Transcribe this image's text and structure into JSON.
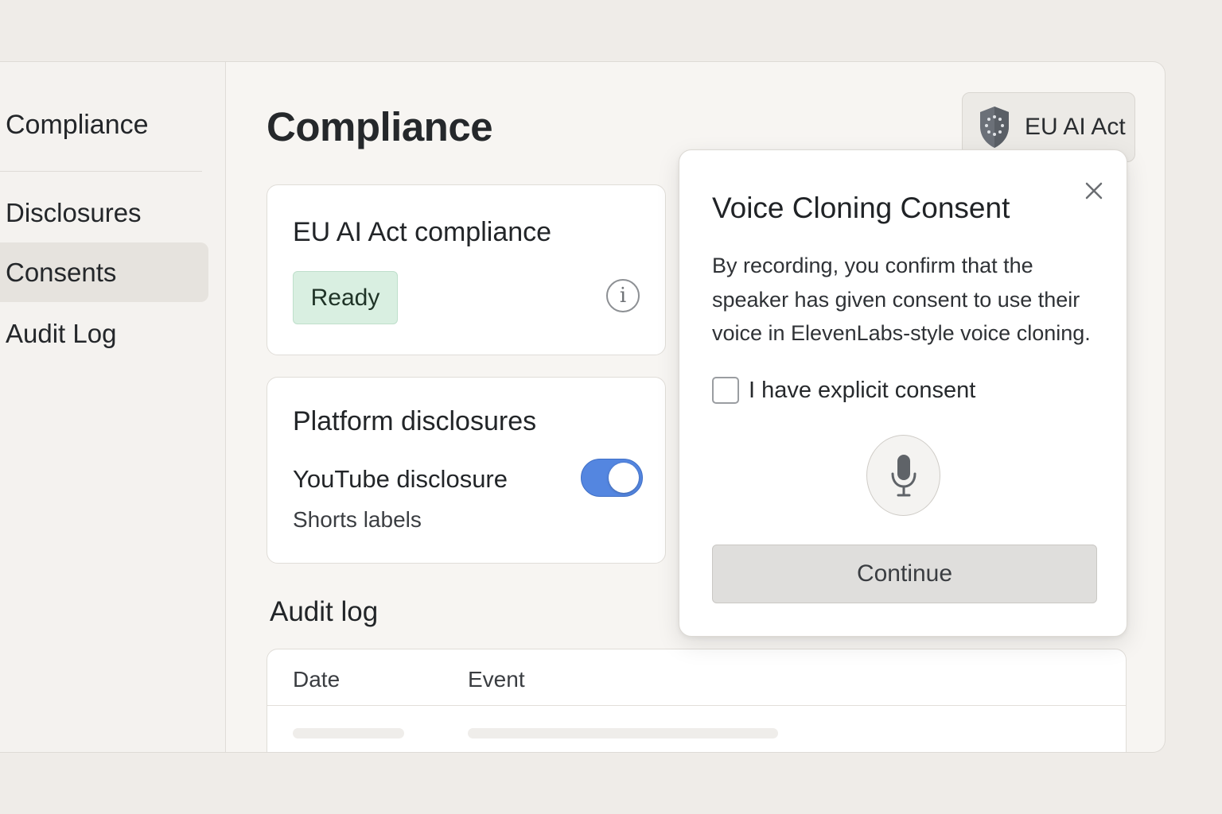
{
  "sidebar": {
    "title": "Compliance",
    "items": [
      {
        "label": "Disclosures"
      },
      {
        "label": "Consents"
      },
      {
        "label": "Audit Log"
      }
    ]
  },
  "header": {
    "title": "Compliance",
    "badge_label": "EU AI Act"
  },
  "ai_act_card": {
    "title": "EU AI Act compliance",
    "status": "Ready"
  },
  "platform_card": {
    "title": "Platform disclosures",
    "item_label": "YouTube disclosure",
    "item_sub": "Shorts labels",
    "toggle_on": true
  },
  "audit": {
    "title": "Audit log",
    "columns": [
      "Date",
      "Event"
    ]
  },
  "modal": {
    "title": "Voice Cloning Consent",
    "body": "By recording, you confirm that the speaker has given consent to use their voice in ElevenLabs-style voice cloning.",
    "checkbox_label": "I have explicit consent",
    "checkbox_checked": false,
    "continue_label": "Continue"
  },
  "colors": {
    "accent": "#5486e0",
    "ready_bg": "#d9efe1",
    "background": "#efece8"
  },
  "icons": [
    "shield-icon",
    "info-icon",
    "close-icon",
    "microphone-icon"
  ]
}
